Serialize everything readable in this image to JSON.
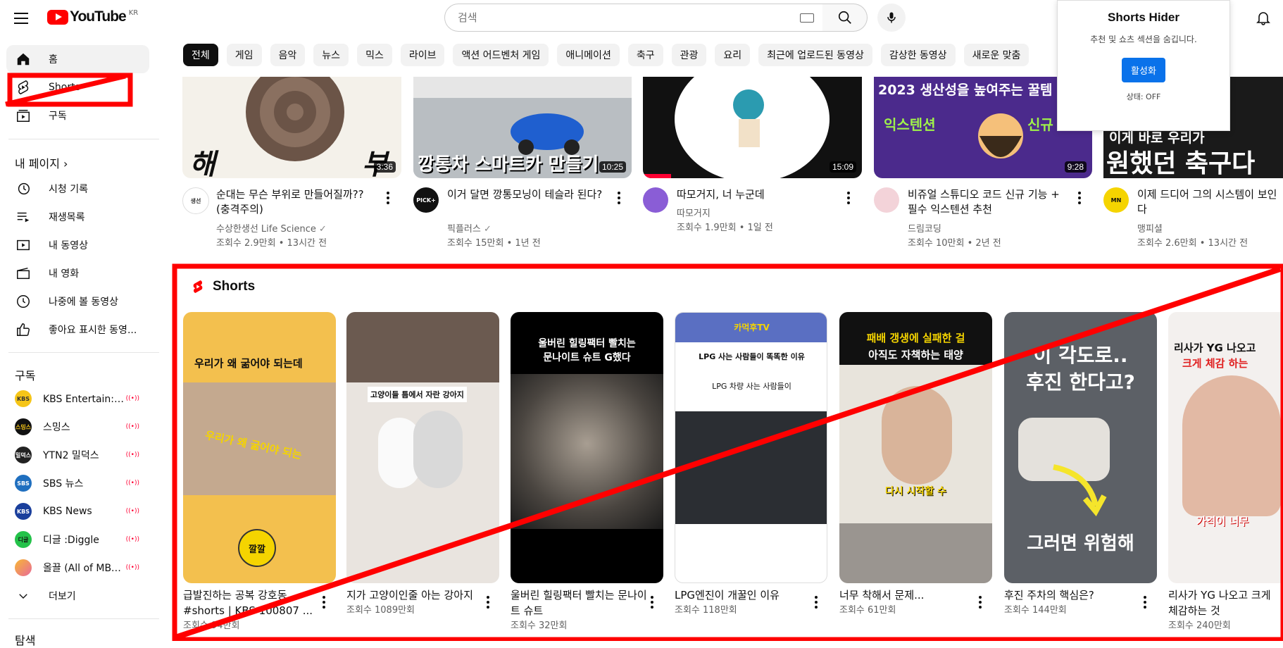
{
  "header": {
    "logo_text": "YouTube",
    "logo_region": "KR",
    "search_placeholder": "검색"
  },
  "sidebar": {
    "main": [
      {
        "label": "홈"
      },
      {
        "label": "Shorts"
      },
      {
        "label": "구독"
      }
    ],
    "my_page_heading": "내 페이지 ›",
    "my_page": [
      {
        "label": "시청 기록"
      },
      {
        "label": "재생목록"
      },
      {
        "label": "내 동영상"
      },
      {
        "label": "내 영화"
      },
      {
        "label": "나중에 볼 동영상"
      },
      {
        "label": "좋아요 표시한 동영..."
      }
    ],
    "subs_heading": "구독",
    "subscriptions": [
      {
        "name": "KBS Entertain: 깔...",
        "avatar": "KBS",
        "color": "#f5c518",
        "live": "((•))"
      },
      {
        "name": "스밍스",
        "avatar": "스밍스",
        "color": "#111111",
        "live": "((•))"
      },
      {
        "name": "YTN2 밀덕스",
        "avatar": "밀덕스",
        "color": "#222222",
        "live": "((•))"
      },
      {
        "name": "SBS 뉴스",
        "avatar": "SBS",
        "color": "#1f6fbf",
        "live": "((•))"
      },
      {
        "name": "KBS News",
        "avatar": "KBS",
        "color": "#1a3f9c",
        "live": "((•))"
      },
      {
        "name": "디글 :Diggle",
        "avatar": "디글",
        "color": "#24c24a",
        "live": "((•))"
      },
      {
        "name": "올끌 (All of MBCI...",
        "avatar": "",
        "color": "#e96a9a",
        "live": "((•))"
      }
    ],
    "more": "더보기",
    "explore_heading": "탐색"
  },
  "chips": [
    "전체",
    "게임",
    "음악",
    "뉴스",
    "믹스",
    "라이브",
    "액션 어드벤처 게임",
    "애니메이션",
    "축구",
    "관광",
    "요리",
    "최근에 업로드된 동영상",
    "감상한 동영상",
    "새로운 맞춤"
  ],
  "videos": [
    {
      "title": "순대는 무슨 부위로 만들어질까?? (충격주의)",
      "channel": "수상한생선 Life Science",
      "verified": "✓",
      "stats": "조회수 2.9만회 • 13시간 전",
      "duration": "3:36",
      "thumb_text_1": "해",
      "thumb_text_2": "부",
      "avatar": "생선",
      "avatar_color": "#ffffff"
    },
    {
      "title": "이거 달면 깡통모닝이 테슬라 된다?",
      "channel": "픽플러스",
      "verified": "✓",
      "stats": "조회수 15만회 • 1년 전",
      "duration": "10:25",
      "thumb_caption": "깡통차 스마트카 만들기",
      "avatar": "PICK+",
      "avatar_color": "#111111"
    },
    {
      "title": "따모거지, 너 누군데",
      "channel": "따모거지",
      "stats": "조회수 1.9만회 • 1일 전",
      "duration": "15:09",
      "avatar": "",
      "avatar_color": "#8a5dd6"
    },
    {
      "title": "비쥬얼 스튜디오 코드 신규 기능 + 필수 익스텐션 추천",
      "channel": "드림코딩",
      "stats": "조회수 10만회 • 2년 전",
      "duration": "9:28",
      "thumb_line_1": "2023 생산성을 높여주는 꿀템",
      "thumb_line_2": "익스텐션",
      "thumb_line_3": "신규",
      "avatar": "",
      "avatar_color": "#f3d3d9"
    },
    {
      "title": "이제 드디어 그의 시스템이 보인다",
      "channel": "맹피셜",
      "stats": "조회수 2.6만회 • 13시간 전",
      "thumb_line_1": "이게 바로 우리가",
      "thumb_line_2": "원했던 축구다",
      "avatar": "MN",
      "avatar_color": "#f5d400"
    }
  ],
  "shorts": {
    "heading": "Shorts",
    "items": [
      {
        "title": "급발진하는 공복 강호동 #shorts | KBS 100807 ...",
        "views": "조회수 94만회",
        "caption_top": "우리가 왜 굶어야 되는데",
        "caption_mid": "우리가 왜 굶어야 되는",
        "caption_bottom": "깔깔"
      },
      {
        "title": "지가 고양이인줄 아는 강아지",
        "views": "조회수 1089만회",
        "caption_top": "고양이들 틈에서 자란 강아지"
      },
      {
        "title": "울버린 힐링팩터 빨치는 문나이트 슈트",
        "views": "조회수 32만회",
        "caption_top": "울버린 힐링팩터 빨치는",
        "caption_bottom": "문나이트 슈트 G했다"
      },
      {
        "title": "LPG엔진이 개꿀인 이유",
        "views": "조회수 118만회",
        "caption_top": "카먹후TV",
        "caption_mid": "LPG 사는 사람들이 똑똑한 이유",
        "caption_bottom": "LPG 차량 사는 사람들이"
      },
      {
        "title": "너무 착해서 문제...",
        "views": "조회수 61만회",
        "caption_top": "패배 갱생에 실패한 걸",
        "caption_mid": "아직도 자책하는 태양",
        "caption_bottom": "다시 시작할 수"
      },
      {
        "title": "후진 주차의 핵심은?",
        "views": "조회수 144만회",
        "caption_top": "이 각도로..",
        "caption_mid": "후진 한다고?",
        "caption_bottom": "그러면 위험해"
      },
      {
        "title": "리사가 YG 나오고 크게 체감하는 것",
        "views": "조회수 240만회",
        "caption_top": "리사가 YG 나오고",
        "caption_mid": "크게 체감 하는",
        "caption_bottom": "가격이 너무"
      }
    ]
  },
  "popup": {
    "title": "Shorts Hider",
    "description": "추천 및 쇼츠 섹션을 숨깁니다.",
    "button": "활성화",
    "status": "상태: OFF"
  },
  "colors": {
    "annotation": "#ff0000",
    "youtube_red": "#ff0000",
    "button_blue": "#0a72ea"
  }
}
